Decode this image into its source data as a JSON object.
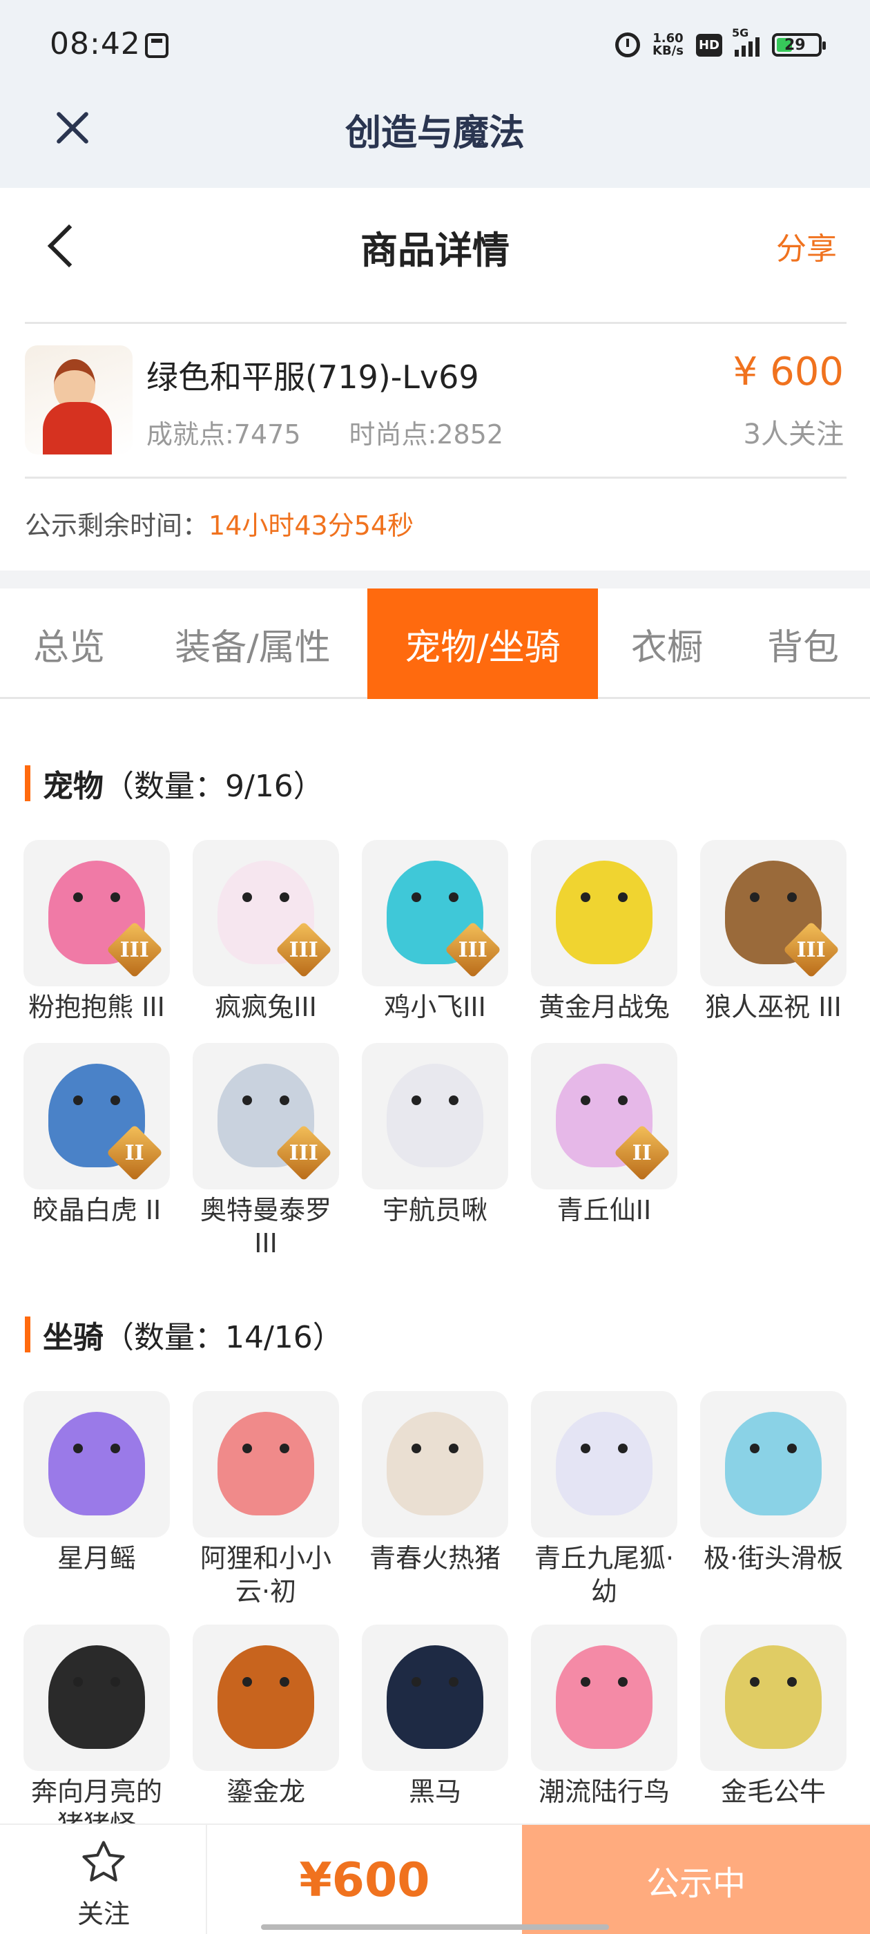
{
  "status_bar": {
    "time": "08:42",
    "speed_value": "1.60",
    "speed_unit": "KB/s",
    "hd_label": "HD",
    "network": "5G",
    "battery": "29"
  },
  "app_bar": {
    "title": "创造与魔法"
  },
  "page_header": {
    "title": "商品详情",
    "share": "分享"
  },
  "product": {
    "name": "绿色和平服(719)-Lv69",
    "achievement": "成就点:7475",
    "fashion": "时尚点:2852",
    "price": "¥ 600",
    "followers": "3人关注"
  },
  "notice": {
    "label": "公示剩余时间：",
    "countdown": "14小时43分54秒"
  },
  "tabs": [
    {
      "label": "总览"
    },
    {
      "label": "装备/属性"
    },
    {
      "label": "宠物/坐骑"
    },
    {
      "label": "衣橱"
    },
    {
      "label": "背包"
    }
  ],
  "pets": {
    "title": "宠物",
    "count": "（数量：9/16）",
    "items": [
      {
        "name": "粉抱抱熊 III",
        "tier": "III",
        "color": "#f07aa6"
      },
      {
        "name": "疯疯兔III",
        "tier": "III",
        "color": "#f6e6ef"
      },
      {
        "name": "鸡小飞III",
        "tier": "III",
        "color": "#3fc8d8"
      },
      {
        "name": "黄金月战兔",
        "tier": "",
        "color": "#f0d430"
      },
      {
        "name": "狼人巫祝 III",
        "tier": "III",
        "color": "#9a6a3a"
      },
      {
        "name": "皎晶白虎 II",
        "tier": "II",
        "color": "#4a82c8"
      },
      {
        "name": "奥特曼泰罗III",
        "tier": "III",
        "color": "#c9d2de"
      },
      {
        "name": "宇航员啾",
        "tier": "",
        "color": "#e8e8ee"
      },
      {
        "name": "青丘仙II",
        "tier": "II",
        "color": "#e6b8e8"
      }
    ]
  },
  "mounts": {
    "title": "坐骑",
    "count": "（数量：14/16）",
    "items": [
      {
        "name": "星月鳐",
        "color": "#9a7ae8"
      },
      {
        "name": "阿狸和小小云·初",
        "color": "#f08a8a"
      },
      {
        "name": "青春火热猪",
        "color": "#eadfd2"
      },
      {
        "name": "青丘九尾狐·幼",
        "color": "#e4e4f4"
      },
      {
        "name": "极·街头滑板",
        "color": "#8ad2e6"
      },
      {
        "name": "奔向月亮的猪猪怪",
        "color": "#2a2a2a"
      },
      {
        "name": "鎏金龙",
        "color": "#c8641e"
      },
      {
        "name": "黑马",
        "color": "#1e2a44"
      },
      {
        "name": "潮流陆行鸟",
        "color": "#f48aa6"
      },
      {
        "name": "金毛公牛",
        "color": "#e0cc64"
      }
    ]
  },
  "bottom": {
    "follow": "关注",
    "price": "¥600",
    "status": "公示中"
  }
}
